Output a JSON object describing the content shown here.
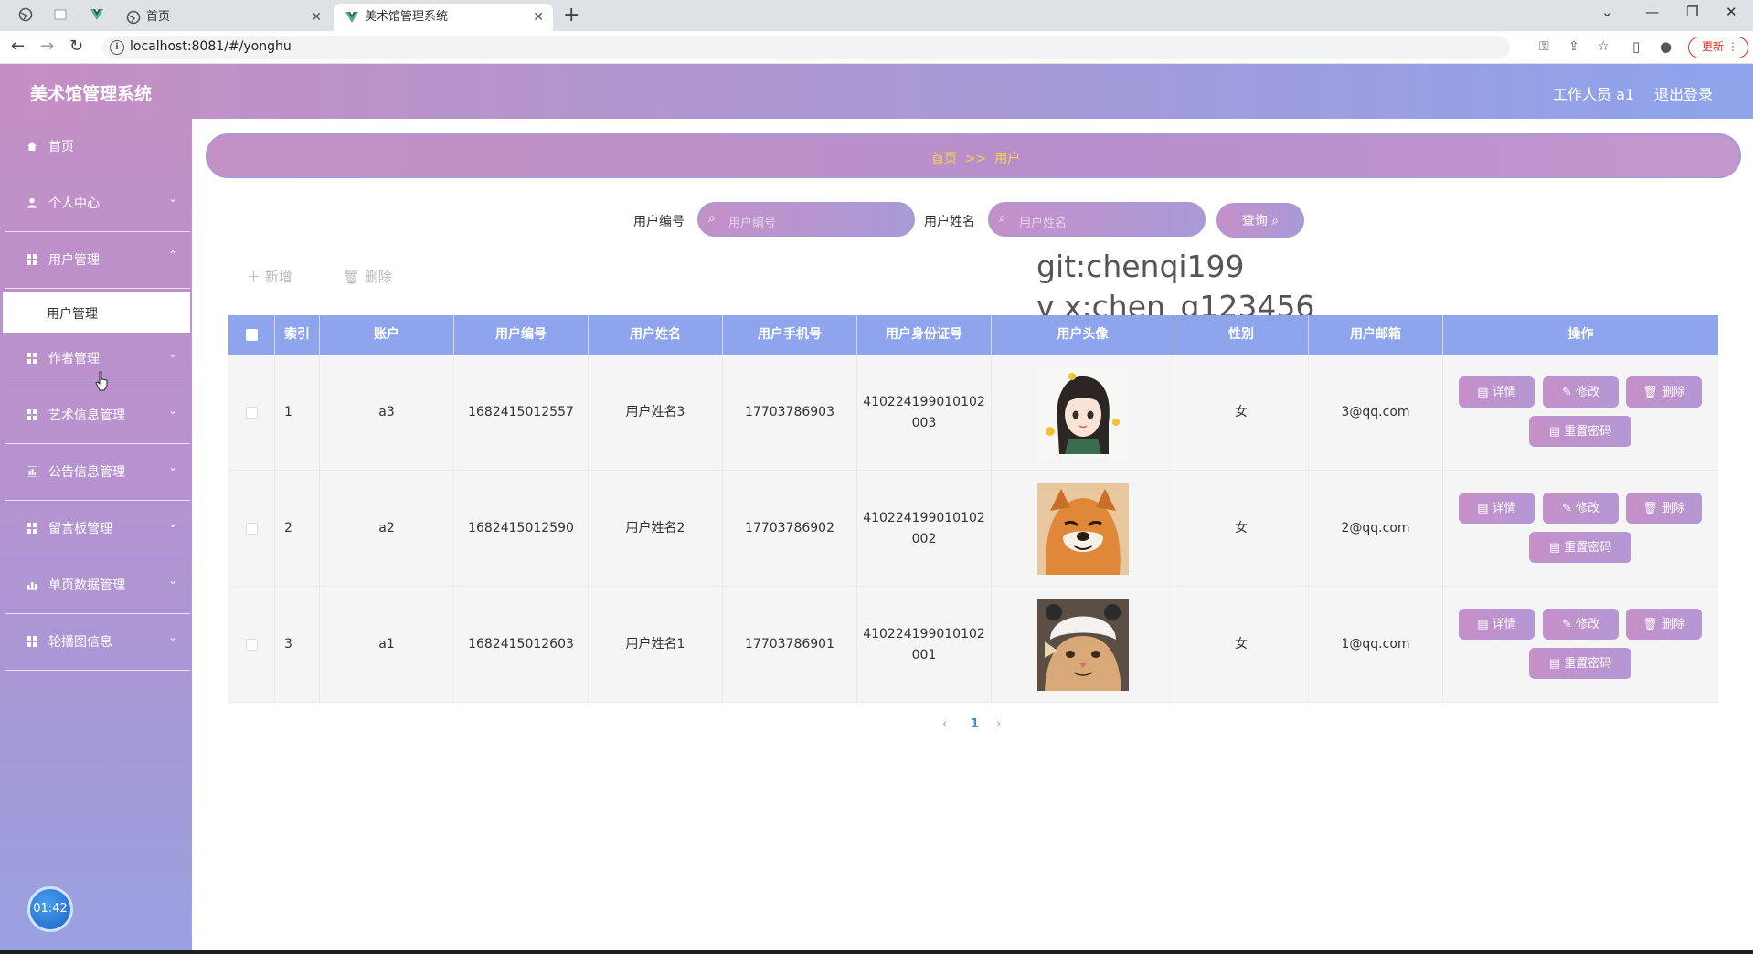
{
  "browser": {
    "tabs": [
      {
        "title": "首页",
        "active": false
      },
      {
        "title": "美术馆管理系统",
        "active": true
      }
    ],
    "url": "localhost:8081/#/yonghu",
    "update_label": "更新"
  },
  "header": {
    "app_title": "美术馆管理系统",
    "user_label": "工作人员 a1",
    "logout_label": "退出登录"
  },
  "sidebar": {
    "items": [
      {
        "label": "首页"
      },
      {
        "label": "个人中心"
      },
      {
        "label": "用户管理"
      },
      {
        "label": "作者管理"
      },
      {
        "label": "艺术信息管理"
      },
      {
        "label": "公告信息管理"
      },
      {
        "label": "留言板管理"
      },
      {
        "label": "单页数据管理"
      },
      {
        "label": "轮播图信息"
      }
    ],
    "submenu_label": "用户管理",
    "timer": "01:42"
  },
  "breadcrumb": "首页  >>  用户",
  "search": {
    "field1_label": "用户编号",
    "field1_placeholder": "用户编号",
    "field2_label": "用户姓名",
    "field2_placeholder": "用户姓名",
    "query_label": "查询"
  },
  "actions": {
    "add_label": "新增",
    "delete_label": "删除"
  },
  "watermark": {
    "line1": "git:chenqi199",
    "line2": "v x:chen_q123456"
  },
  "table": {
    "headers": [
      "索引",
      "账户",
      "用户编号",
      "用户姓名",
      "用户手机号",
      "用户身份证号",
      "用户头像",
      "性别",
      "用户邮箱",
      "操作"
    ],
    "rows": [
      {
        "index": "1",
        "account": "a3",
        "user_no": "1682415012557",
        "name": "用户姓名3",
        "phone": "17703786903",
        "id_line1": "410224199010102",
        "id_line2": "003",
        "avatar": "anime-girl",
        "gender": "女",
        "email": "3@qq.com"
      },
      {
        "index": "2",
        "account": "a2",
        "user_no": "1682415012590",
        "name": "用户姓名2",
        "phone": "17703786902",
        "id_line1": "410224199010102",
        "id_line2": "002",
        "avatar": "shiba-dog",
        "gender": "女",
        "email": "2@qq.com"
      },
      {
        "index": "3",
        "account": "a1",
        "user_no": "1682415012603",
        "name": "用户姓名1",
        "phone": "17703786901",
        "id_line1": "410224199010102",
        "id_line2": "001",
        "avatar": "cat-hat",
        "gender": "女",
        "email": "1@qq.com"
      }
    ],
    "op_labels": {
      "detail": "详情",
      "edit": "修改",
      "delete": "删除",
      "reset": "重置密码"
    }
  },
  "pagination": {
    "current": "1"
  },
  "colors": {
    "header_start": "#c68fc3",
    "header_end": "#8ea4ec",
    "table_head": "#8ea4ec",
    "breadcrumb_text": "#f6d34a"
  }
}
